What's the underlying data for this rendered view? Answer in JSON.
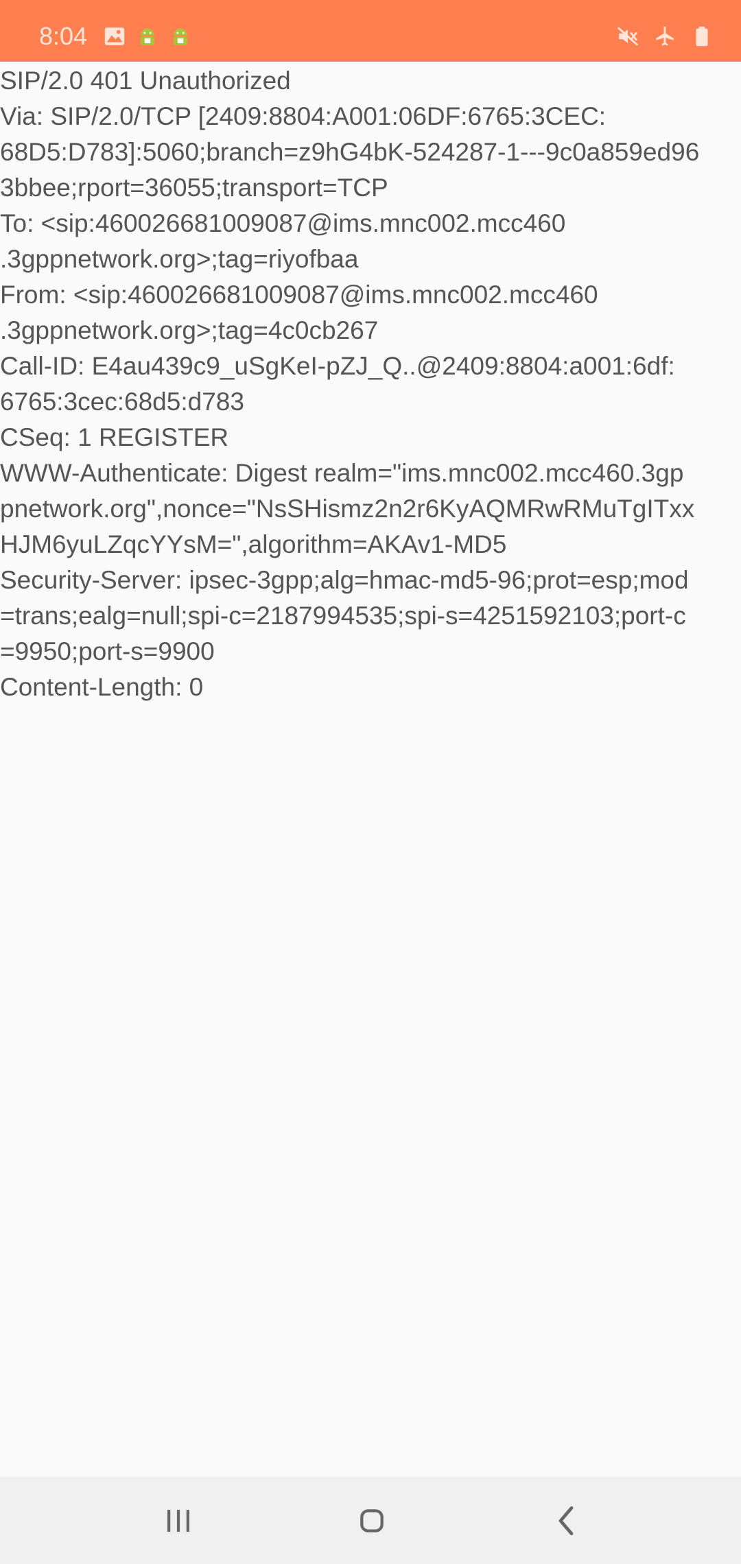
{
  "status_bar": {
    "time": "8:04",
    "left_icons": [
      "image-icon",
      "android-icon",
      "android-icon"
    ],
    "right_icons": [
      "vibrate-mute-icon",
      "airplane-icon",
      "battery-icon"
    ],
    "background_color": "#ff7f50"
  },
  "message": {
    "lines": [
      "SIP/2.0 401 Unauthorized",
      "Via: SIP/2.0/TCP [2409:8804:A001:06DF:6765:3CEC:",
      "68D5:D783]:5060;branch=z9hG4bK-524287-1---9c0a859ed96",
      "3bbee;rport=36055;transport=TCP",
      "To: <sip:460026681009087@ims.mnc002.mcc460",
      ".3gppnetwork.org>;tag=riyofbaa",
      "From: <sip:460026681009087@ims.mnc002.mcc460",
      ".3gppnetwork.org>;tag=4c0cb267",
      "Call-ID: E4au439c9_uSgKeI-pZJ_Q..@2409:8804:a001:6df:",
      "6765:3cec:68d5:d783",
      "CSeq: 1 REGISTER",
      "WWW-Authenticate: Digest realm=\"ims.mnc002.mcc460.3gp",
      "pnetwork.org\",nonce=\"NsSHismz2n2r6KyAQMRwRMuTgITxx",
      "HJM6yuLZqcYYsM=\",algorithm=AKAv1-MD5",
      "Security-Server: ipsec-3gpp;alg=hmac-md5-96;prot=esp;mod",
      "=trans;ealg=null;spi-c=2187994535;spi-s=4251592103;port-c",
      "=9950;port-s=9900",
      "Content-Length: 0"
    ]
  },
  "nav_bar": {
    "buttons": [
      "recents-icon",
      "home-icon",
      "back-icon"
    ]
  }
}
